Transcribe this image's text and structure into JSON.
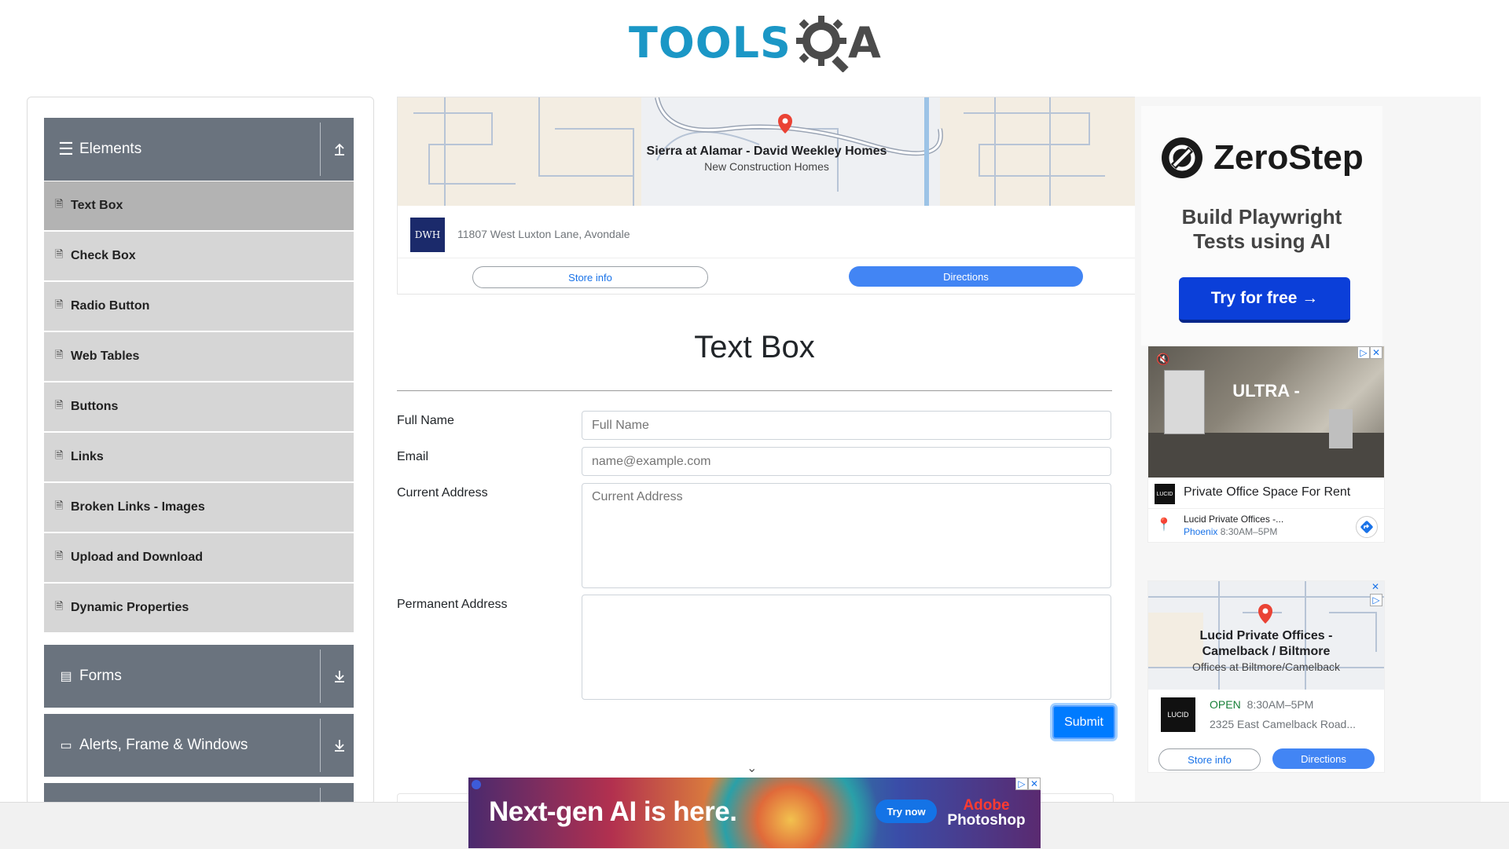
{
  "header": {
    "logo_main": "TOOLS",
    "logo_qa": "QA"
  },
  "sidebar": {
    "elements_group": {
      "label": "Elements",
      "icon": "hamburger-icon",
      "arrow": "collapse-arrow-icon"
    },
    "items": [
      {
        "label": "Text Box",
        "active": true
      },
      {
        "label": "Check Box"
      },
      {
        "label": "Radio Button"
      },
      {
        "label": "Web Tables"
      },
      {
        "label": "Buttons"
      },
      {
        "label": "Links"
      },
      {
        "label": "Broken Links - Images"
      },
      {
        "label": "Upload and Download"
      },
      {
        "label": "Dynamic Properties"
      }
    ],
    "forms_group": {
      "label": "Forms",
      "icon": "form-icon",
      "arrow": "expand-arrow-icon"
    },
    "alerts_group": {
      "label": "Alerts, Frame & Windows",
      "icon": "window-icon",
      "arrow": "expand-arrow-icon"
    }
  },
  "top_map_ad": {
    "place_name": "Sierra at Alamar - David Weekley Homes",
    "place_type": "New Construction Homes",
    "logo_text": "DWH",
    "address": "11807 West Luxton Lane, Avondale",
    "store_info": "Store info",
    "directions": "Directions"
  },
  "form": {
    "title": "Text Box",
    "full_name_label": "Full Name",
    "full_name_placeholder": "Full Name",
    "email_label": "Email",
    "email_placeholder": "name@example.com",
    "current_address_label": "Current Address",
    "current_address_placeholder": "Current Address",
    "permanent_address_label": "Permanent Address",
    "permanent_address_placeholder": "",
    "submit_label": "Submit"
  },
  "zerostep_ad": {
    "brand": "ZeroStep",
    "headline_line1": "Build Playwright",
    "headline_line2": "Tests using AI",
    "cta": "Try for free →"
  },
  "video_ad": {
    "overlay_text": "ULTRA -",
    "title": "Private Office Space For Rent",
    "business": "Lucid Private Offices -...",
    "city": "Phoenix",
    "hours": "8:30AM–5PM",
    "logo_text": "LUCID"
  },
  "map_ad2": {
    "place_line1": "Lucid Private Offices -",
    "place_line2": "Camelback / Biltmore",
    "place_sub": "Offices at Biltmore/Camelback",
    "status": "OPEN",
    "hours": "8:30AM–5PM",
    "address": "2325 East Camelback Road...",
    "logo_text": "LUCID",
    "store_info": "Store info",
    "directions": "Directions"
  },
  "bottom_banner": {
    "headline": "Next-gen AI is here.",
    "cta": "Try now",
    "brand_line1": "Adobe",
    "brand_line2": "Photoshop"
  },
  "colors": {
    "sidebar_header": "#6a737e",
    "menu_item": "#d6d6d6",
    "menu_item_active": "#b3b3b3",
    "submit": "#007bff",
    "logo_blue": "#1b97c6",
    "directions_blue": "#4285f4"
  }
}
